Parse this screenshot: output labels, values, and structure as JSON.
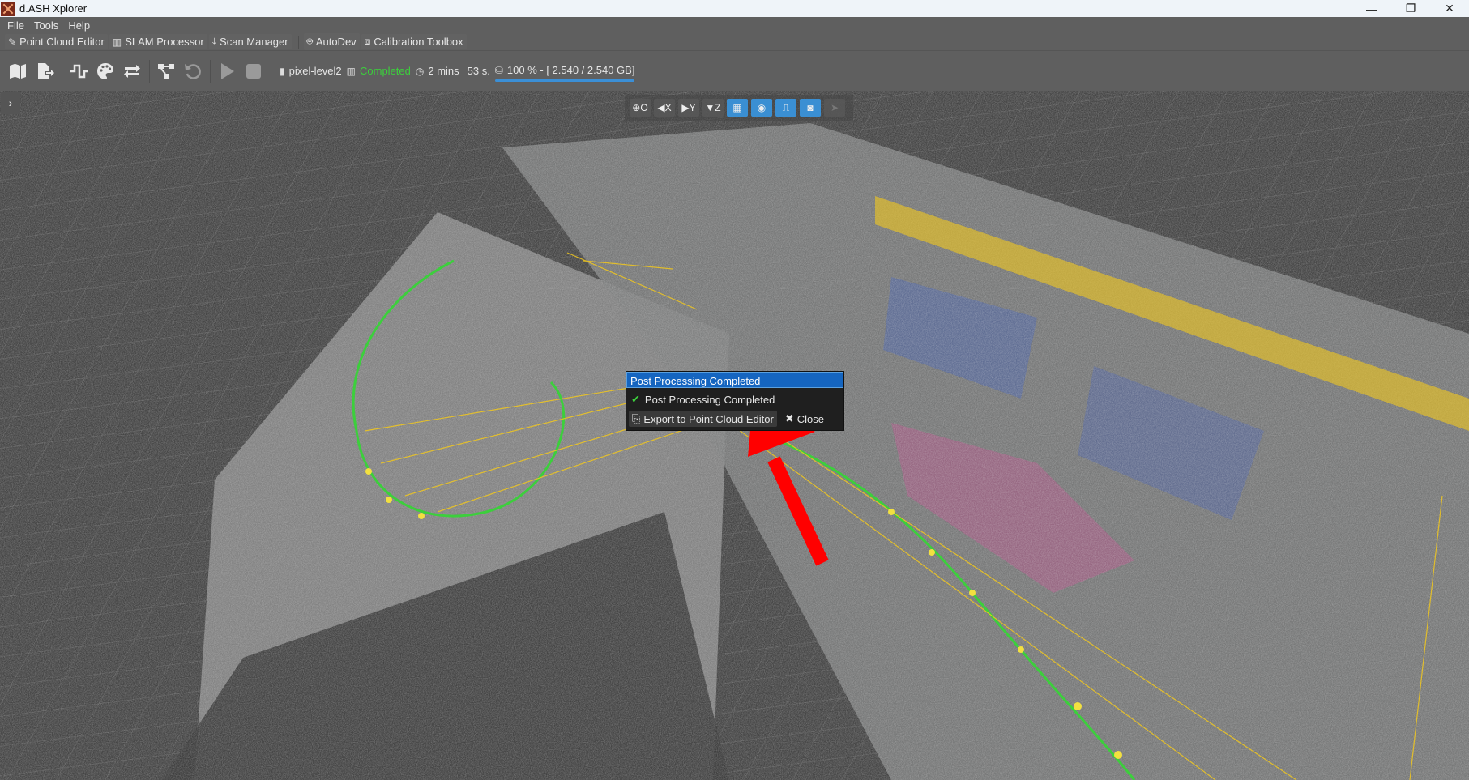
{
  "window": {
    "title": "d.ASH Xplorer",
    "controls": {
      "minimize": "—",
      "restore": "❐",
      "close": "✕"
    }
  },
  "menu": {
    "items": [
      {
        "label": "File"
      },
      {
        "label": "Tools"
      },
      {
        "label": "Help"
      }
    ]
  },
  "modules": {
    "tabs": [
      {
        "label": "Point Cloud Editor",
        "icon": "edit-icon"
      },
      {
        "label": "SLAM Processor",
        "icon": "map-icon"
      },
      {
        "label": "Scan Manager",
        "icon": "download-icon"
      },
      {
        "label": "AutoDev",
        "icon": "robot-icon"
      },
      {
        "label": "Calibration Toolbox",
        "icon": "toolbox-icon"
      }
    ]
  },
  "toolbar": {
    "buttons": [
      {
        "name": "map",
        "icon": "map-icon"
      },
      {
        "name": "export",
        "icon": "file-export-icon"
      },
      {
        "name": "trajectory",
        "icon": "wave-icon"
      },
      {
        "name": "colorize",
        "icon": "palette-icon"
      },
      {
        "name": "swap",
        "icon": "arrows-swap-icon"
      },
      {
        "name": "graph",
        "icon": "graph-nodes-icon"
      },
      {
        "name": "undo",
        "icon": "undo-icon"
      },
      {
        "name": "play",
        "icon": "play-icon"
      },
      {
        "name": "stop",
        "icon": "stop-icon"
      }
    ],
    "status": {
      "file_name": "pixel-level2",
      "state": "Completed",
      "duration_min": "2 mins",
      "duration_sec": "53 s.",
      "storage_text": "100 % - [ 2.540 / 2.540 GB]",
      "storage_progress": 1.0
    }
  },
  "viewport": {
    "side_toggle": "›",
    "view_buttons": [
      {
        "label": "O",
        "icon": "globe-icon",
        "active": false
      },
      {
        "label": "X",
        "icon": "arrow-left-circle-icon",
        "active": false
      },
      {
        "label": "Y",
        "icon": "arrow-right-circle-icon",
        "active": false
      },
      {
        "label": "Z",
        "icon": "arrow-down-circle-icon",
        "active": false
      },
      {
        "label": "",
        "icon": "grid-pattern-icon",
        "active": true
      },
      {
        "label": "",
        "icon": "target-circle-icon",
        "active": true
      },
      {
        "label": "",
        "icon": "trajectory-icon",
        "active": true
      },
      {
        "label": "",
        "icon": "camera-icon",
        "active": true
      },
      {
        "label": "",
        "icon": "navigation-icon",
        "active": false,
        "disabled": true
      }
    ]
  },
  "popup": {
    "title": "Post Processing Completed",
    "message": "Post Processing Completed",
    "export_label": "Export to Point Cloud Editor",
    "close_label": "Close"
  },
  "colors": {
    "accent": "#3a8fd3",
    "popup_header": "#1565c0",
    "success": "#3ccf3c",
    "trajectory": "#f2c81e",
    "annotation_arrow": "#ff0000"
  }
}
